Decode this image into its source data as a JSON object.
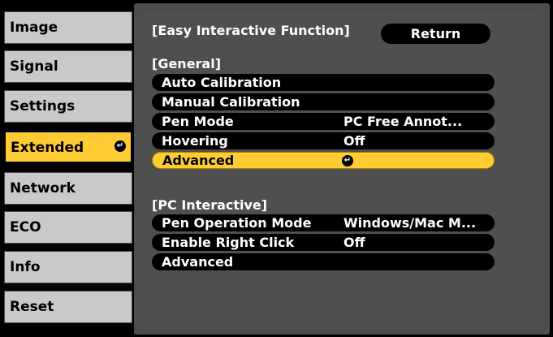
{
  "nav": {
    "items": [
      {
        "label": "Image"
      },
      {
        "label": "Signal"
      },
      {
        "label": "Settings"
      },
      {
        "label": "Extended"
      },
      {
        "label": "Network"
      },
      {
        "label": "ECO"
      },
      {
        "label": "Info"
      },
      {
        "label": "Reset"
      }
    ],
    "active_index": 3
  },
  "content": {
    "title": "[Easy Interactive Function]",
    "return_label": "Return",
    "general_header": "[General]",
    "general_rows": [
      {
        "label": "Auto Calibration",
        "value": ""
      },
      {
        "label": "Manual Calibration",
        "value": ""
      },
      {
        "label": "Pen Mode",
        "value": "PC Free Annot..."
      },
      {
        "label": "Hovering",
        "value": "Off"
      },
      {
        "label": "Advanced",
        "value": ""
      }
    ],
    "pc_header": "[PC Interactive]",
    "pc_rows": [
      {
        "label": "Pen Operation Mode",
        "value": "Windows/Mac M..."
      },
      {
        "label": "Enable Right Click",
        "value": "Off"
      },
      {
        "label": "Advanced",
        "value": ""
      }
    ]
  },
  "colors": {
    "accent": "#ffcc33",
    "nav_bg": "#c9c9c9",
    "content_bg": "#4f4f4f"
  }
}
